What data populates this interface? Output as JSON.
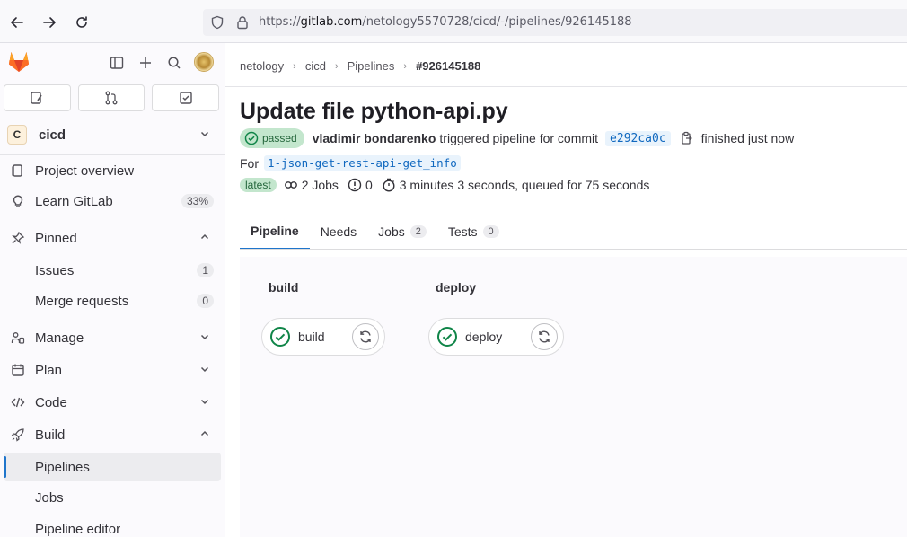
{
  "browser": {
    "url_prefix": "https://",
    "url_domain": "gitlab.com",
    "url_path": "/netology5570728/cicd/-/pipelines/926145188"
  },
  "sidebar": {
    "project_initial": "C",
    "project_name": "cicd",
    "items": {
      "project_overview": "Project overview",
      "learn_gitlab": "Learn GitLab",
      "learn_gitlab_progress": "33%",
      "pinned": "Pinned",
      "issues": "Issues",
      "issues_count": "1",
      "merge_requests": "Merge requests",
      "merge_requests_count": "0",
      "manage": "Manage",
      "plan": "Plan",
      "code": "Code",
      "build": "Build",
      "pipelines": "Pipelines",
      "jobs": "Jobs",
      "pipeline_editor": "Pipeline editor"
    }
  },
  "breadcrumb": {
    "group": "netology",
    "project": "cicd",
    "section": "Pipelines",
    "current": "#926145188"
  },
  "pipeline": {
    "title": "Update file python-api.py",
    "status": "passed",
    "user": "vladimir bondarenko",
    "triggered_text": "triggered pipeline for commit",
    "commit_sha": "e292ca0c",
    "finished_text": "finished just now",
    "for_label": "For",
    "ref": "1-json-get-rest-api-get_info",
    "latest_label": "latest",
    "jobs_text": "2 Jobs",
    "warnings_count": "0",
    "duration_text": "3 minutes 3 seconds, queued for 75 seconds"
  },
  "tabs": [
    {
      "label": "Pipeline",
      "count": ""
    },
    {
      "label": "Needs",
      "count": ""
    },
    {
      "label": "Jobs",
      "count": "2"
    },
    {
      "label": "Tests",
      "count": "0"
    }
  ],
  "graph": {
    "stages": [
      {
        "name": "build",
        "job": "build"
      },
      {
        "name": "deploy",
        "job": "deploy"
      }
    ]
  },
  "colors": {
    "success": "#108548",
    "accent": "#1f75cb",
    "badge_green_bg": "#c3e6cd"
  }
}
